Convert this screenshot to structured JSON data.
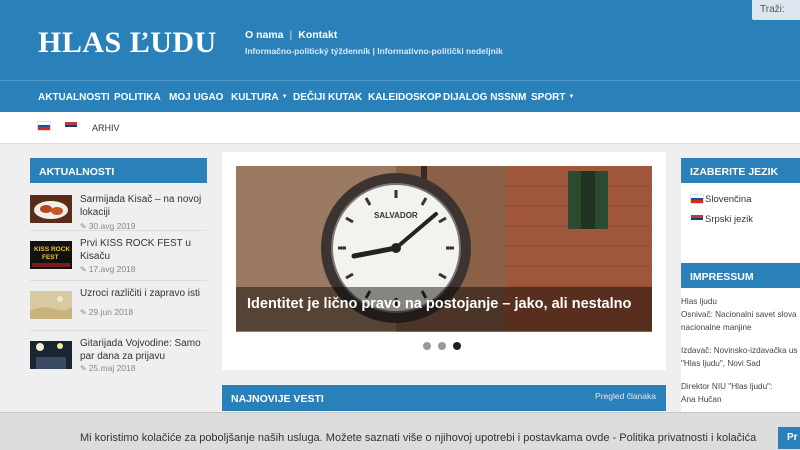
{
  "header": {
    "logo": "HLAS ĽUDU",
    "links": [
      "O nama",
      "Kontakt"
    ],
    "tagline": "Informačno-politický týždenník | Informativno-politički nedeljnik",
    "search_label": "Traži:"
  },
  "nav": {
    "items": [
      {
        "label": "AKTUALNOSTI"
      },
      {
        "label": "POLITIKA"
      },
      {
        "label": "MOJ UGAO"
      },
      {
        "label": "KULTURA",
        "dropdown": true
      },
      {
        "label": "DEČIJI KUTAK"
      },
      {
        "label": "KALEIDOSKOP"
      },
      {
        "label": "DIJALOG NSSNM"
      },
      {
        "label": "SPORT",
        "dropdown": true
      }
    ]
  },
  "subbar": {
    "archive": "ARHIV"
  },
  "left": {
    "title": "AKTUALNOSTI",
    "news": [
      {
        "title": "Sarmijada Kisač – na novoj lokaciji",
        "date": "30.avg 2019"
      },
      {
        "title": "Prvi KISS ROCK FEST u Kisaču",
        "date": "17.avg 2018"
      },
      {
        "title": "Uzroci različiti i zapravo isti",
        "date": "29.jun 2018"
      },
      {
        "title": "Gitarijada Vojvodine: Samo par dana za prijavu",
        "date": "25.maj 2018"
      }
    ]
  },
  "slider": {
    "caption": "Identitet je lično pravo na postojanje – jako, ali nestalno",
    "clock_brand": "SALVADOR",
    "slides": 3,
    "active_slide": 3
  },
  "latest": {
    "title": "NAJNOVIJE VESTI",
    "link": "Pregled članaka"
  },
  "right": {
    "lang_title": "IZABERITE JEZIK",
    "languages": [
      "Slovenčina",
      "Srpski jezik"
    ],
    "impressum_title": "IMPRESSUM",
    "impressum_lines": [
      "Hlas ljudu",
      "Osnivač: Nacionalni savet slova",
      "nacionalne manjine",
      "Izdavač: Novinsko-izdavačka us",
      "\"Hlas ljudu\", Novi Sad",
      "Direktor NIU \"Hlas ljudu\":",
      "Ana Hučan"
    ]
  },
  "cookie": {
    "text": "Mi koristimo kolačiće za poboljšanje naših usluga. Možete saznati više o njihovoj upotrebi i postavkama ovde - Politika privatnosti i kolačića",
    "button": "Pr"
  },
  "colors": {
    "brand": "#2a80b9",
    "background": "#efefef"
  }
}
